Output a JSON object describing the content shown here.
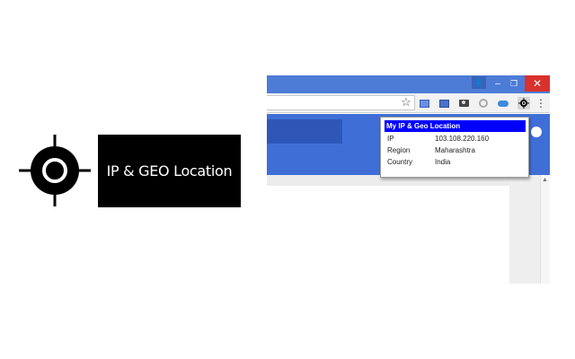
{
  "logo": {
    "icon": "crosshair-icon",
    "text": "IP & GEO Location"
  },
  "browser": {
    "window_controls": {
      "user": "👤",
      "minimize": "–",
      "maximize": "❐",
      "close": "✕"
    },
    "toolbar_icons": [
      "star-icon",
      "cast-icon",
      "image-icon",
      "camera-icon",
      "circle-icon",
      "cloud-icon",
      "crosshair-icon",
      "menu-icon"
    ],
    "star_glyph": "☆",
    "menu_glyph": "⋮"
  },
  "popup": {
    "title": "My IP & Geo Location",
    "rows": [
      {
        "key": "IP",
        "value": "103.108.220.160"
      },
      {
        "key": "Region",
        "value": "Maharashtra"
      },
      {
        "key": "Country",
        "value": "India"
      }
    ]
  },
  "colors": {
    "title_bar": "#4d7cd7",
    "page_header": "#3f6fd6",
    "popup_title_bg": "#0000ff",
    "close_button": "#d9312b"
  }
}
